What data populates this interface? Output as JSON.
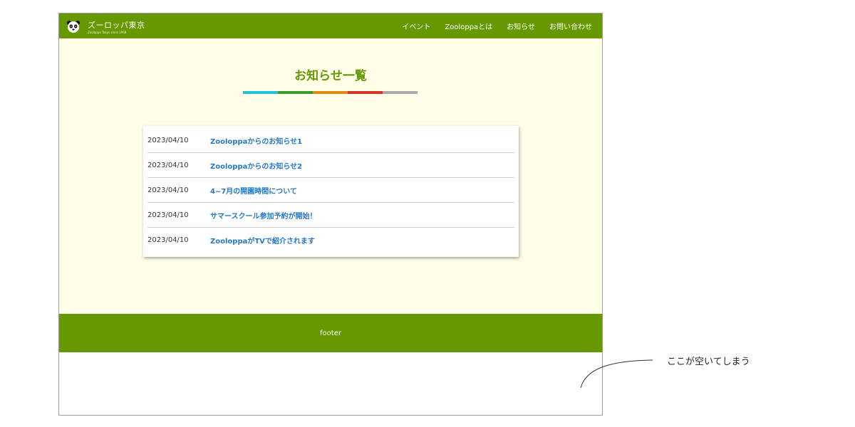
{
  "header": {
    "brand_name": "ズーロッパ東京",
    "brand_sub": "Zooloppa Tokyo since 1968",
    "nav": [
      "イベント",
      "Zooloppaとは",
      "お知らせ",
      "お問い合わせ"
    ]
  },
  "main": {
    "title": "お知らせ一覧",
    "title_bar_colors": [
      "#1fc2d6",
      "#3c9a2a",
      "#e08a12",
      "#d6322a",
      "#aaaaaa"
    ],
    "news": [
      {
        "date": "2023/04/10",
        "title": "Zooloppaからのお知らせ1"
      },
      {
        "date": "2023/04/10",
        "title": "Zooloppaからのお知らせ2"
      },
      {
        "date": "2023/04/10",
        "title": "4~7月の開園時間について"
      },
      {
        "date": "2023/04/10",
        "title": "サマースクール参加予約が開始！"
      },
      {
        "date": "2023/04/10",
        "title": "ZooloppaがTVで紹介されます"
      }
    ]
  },
  "footer": {
    "label": "footer"
  },
  "annotation": {
    "note": "ここが空いてしまう"
  },
  "colors": {
    "header_green": "#669900",
    "main_bg": "#fefee8",
    "link_blue": "#2478c8"
  }
}
